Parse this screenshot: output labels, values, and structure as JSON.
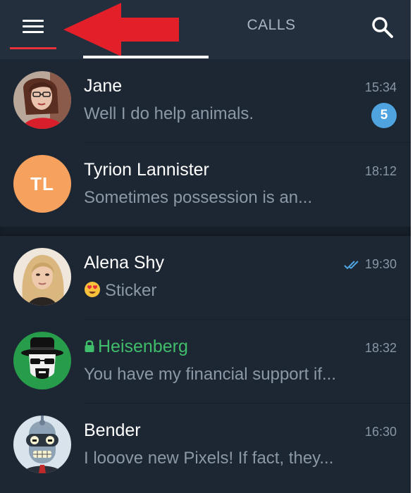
{
  "header": {
    "tabs": [
      {
        "label": ""
      },
      {
        "label": "CALLS"
      }
    ]
  },
  "chats": [
    {
      "name": "Jane",
      "time": "15:34",
      "preview": "Well I do help animals.",
      "unread": "5",
      "avatar": "photo"
    },
    {
      "name": "Tyrion Lannister",
      "time": "18:12",
      "preview": "Sometimes possession is an...",
      "avatar_initials": "TL"
    },
    {
      "name": "Alena Shy",
      "time": "19:30",
      "preview": "Sticker",
      "read_status": "double-check-icon"
    },
    {
      "name": "Heisenberg",
      "time": "18:32",
      "preview": "You have my financial support if...",
      "secret": true
    },
    {
      "name": "Bender",
      "time": "16:30",
      "preview": "I looove new Pixels! If fact, they..."
    }
  ],
  "colors": {
    "background": "#1d2733",
    "header": "#232f3d",
    "accent_red": "#e8303a",
    "secret_green": "#3fbd6b",
    "badge_blue": "#4fa3df",
    "initials_orange": "#f7a15f"
  }
}
